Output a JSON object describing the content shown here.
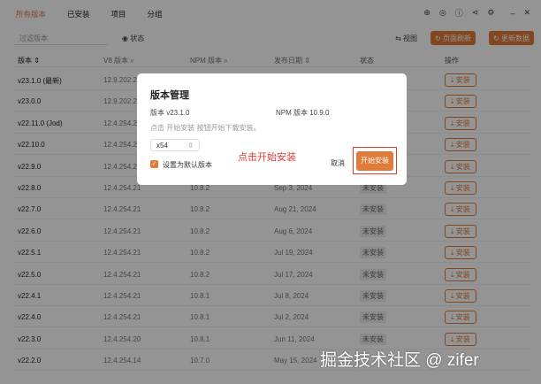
{
  "tabs": [
    "所有版本",
    "已安装",
    "项目",
    "分组"
  ],
  "title_icons": [
    "globe-icon",
    "palette-icon",
    "info-icon",
    "share-icon",
    "gear-icon",
    "minimize-icon",
    "close-icon"
  ],
  "toolbar": {
    "filter_placeholder": "过滤版本",
    "status_label": "状态",
    "view_label": "视图",
    "refresh_page": "页面刷新",
    "update_data": "更新数据"
  },
  "columns": [
    "版本",
    "V8 版本",
    "NPM 版本",
    "发布日期",
    "状态",
    "操作"
  ],
  "rows": [
    {
      "version": "v23.1.0 (最新)",
      "v8": "12.9.202.2",
      "npm": "",
      "date": "",
      "status": "",
      "action": "安装"
    },
    {
      "version": "v23.0.0",
      "v8": "12.9.202.2",
      "npm": "",
      "date": "",
      "status": "",
      "action": "安装"
    },
    {
      "version": "v22.11.0 (Jod)",
      "v8": "12.4.254.2",
      "npm": "",
      "date": "",
      "status": "",
      "action": "安装"
    },
    {
      "version": "v22.10.0",
      "v8": "12.4.254.2",
      "npm": "",
      "date": "",
      "status": "",
      "action": "安装"
    },
    {
      "version": "v22.9.0",
      "v8": "12.4.254.2",
      "npm": "",
      "date": "",
      "status": "",
      "action": "安装"
    },
    {
      "version": "v22.8.0",
      "v8": "12.4.254.21",
      "npm": "10.8.2",
      "date": "Sep 3, 2024",
      "status": "未安装",
      "action": "安装"
    },
    {
      "version": "v22.7.0",
      "v8": "12.4.254.21",
      "npm": "10.8.2",
      "date": "Aug 21, 2024",
      "status": "未安装",
      "action": "安装"
    },
    {
      "version": "v22.6.0",
      "v8": "12.4.254.21",
      "npm": "10.8.2",
      "date": "Aug 6, 2024",
      "status": "未安装",
      "action": "安装"
    },
    {
      "version": "v22.5.1",
      "v8": "12.4.254.21",
      "npm": "10.8.2",
      "date": "Jul 19, 2024",
      "status": "未安装",
      "action": "安装"
    },
    {
      "version": "v22.5.0",
      "v8": "12.4.254.21",
      "npm": "10.8.2",
      "date": "Jul 17, 2024",
      "status": "未安装",
      "action": "安装"
    },
    {
      "version": "v22.4.1",
      "v8": "12.4.254.21",
      "npm": "10.8.1",
      "date": "Jul 8, 2024",
      "status": "未安装",
      "action": "安装"
    },
    {
      "version": "v22.4.0",
      "v8": "12.4.254.21",
      "npm": "10.8.1",
      "date": "Jul 2, 2024",
      "status": "未安装",
      "action": "安装"
    },
    {
      "version": "v22.3.0",
      "v8": "12.4.254.20",
      "npm": "10.8.1",
      "date": "Jun 11, 2024",
      "status": "未安装",
      "action": "安装"
    },
    {
      "version": "v22.2.0",
      "v8": "12.4.254.14",
      "npm": "10.7.0",
      "date": "May 15, 2024",
      "status": "",
      "action": ""
    }
  ],
  "modal": {
    "title": "版本管理",
    "version": "版本  v23.1.0",
    "npm": "NPM 版本  10.9.0",
    "hint": "点击 开始安装 按钮开始下载安装。",
    "arch": "x54",
    "default_label": "设置为默认版本",
    "cancel": "取消",
    "start": "开始安装"
  },
  "annotation": "点击开始安装",
  "watermark": "掘金技术社区 @ zifer",
  "colors": {
    "accent": "#e07b39",
    "annotation": "#e53935"
  }
}
